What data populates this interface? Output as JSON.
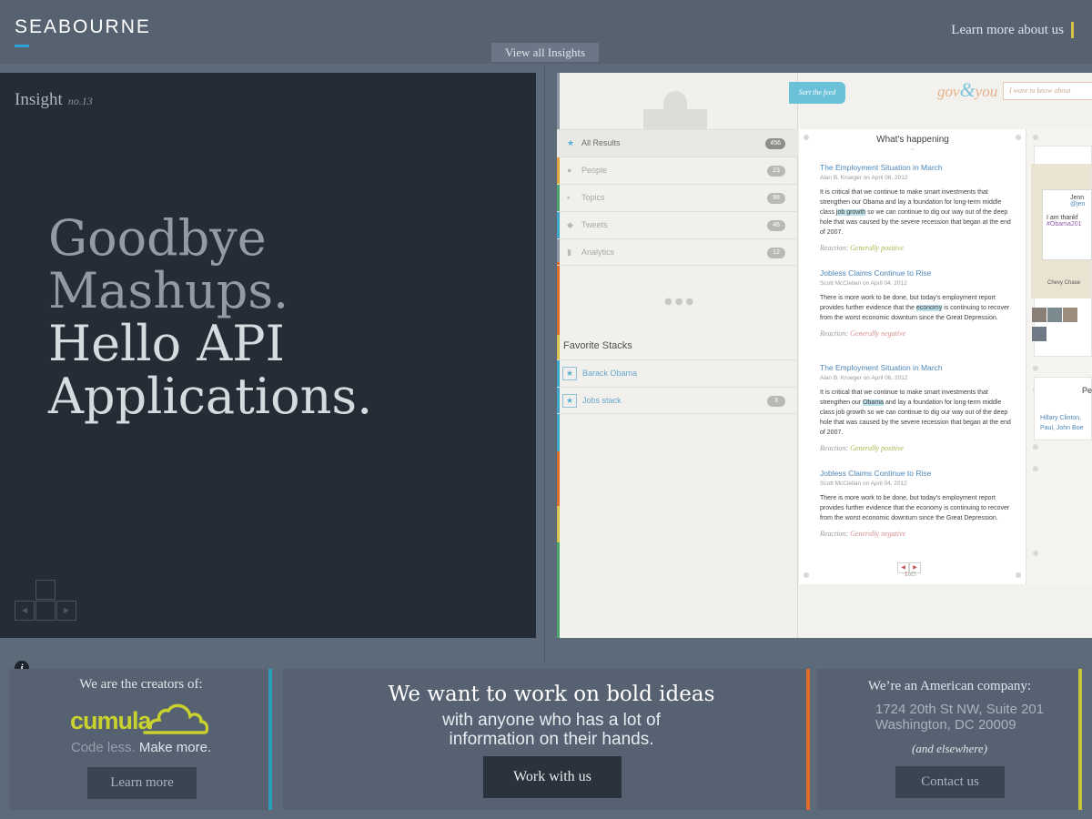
{
  "header": {
    "brand": "SEABOURNE",
    "learn_about": "Learn more about us",
    "view_all": "View all Insights"
  },
  "insight": {
    "label": "Insight",
    "number": "no.13",
    "headline": [
      "Goodbye",
      "Mashups.",
      "Hello API",
      "Applications."
    ]
  },
  "app": {
    "sort_label": "Sort the feed",
    "logo_gov": "gov",
    "logo_amp": "&",
    "logo_you": "you",
    "search_placeholder": "I want to know about",
    "menu": [
      {
        "label": "All Results",
        "count": "456"
      },
      {
        "label": "People",
        "count": "23"
      },
      {
        "label": "Topics",
        "count": "98"
      },
      {
        "label": "Tweets",
        "count": "46"
      },
      {
        "label": "Analytics",
        "count": "12"
      }
    ],
    "favorites_title": "Favorite Stacks",
    "favorites": [
      {
        "label": "Barack Obama",
        "count": ""
      },
      {
        "label": "Jobs stack",
        "count": "3"
      }
    ],
    "feed_title": "What's happening",
    "articles": [
      {
        "title": "The Employment Situation in March",
        "byline": "Alan B. Krueger on April 06, 2012",
        "body_a": "It is critical that we continue to make smart investments that strengthen our Obama and lay a foundation for long-term middle class ",
        "highlight": "job growth",
        "body_b": " so we can continue to dig our way out of the deep hole that was caused by the severe recession that began at the end of 2007.",
        "reaction_label": "Reaction:",
        "reaction": "Generally positive"
      },
      {
        "title": "Jobless Claims Continue to Rise",
        "byline": "Scott McClellan on April 04, 2012",
        "body_a": "There is more work to be done, but today's employment report provides further evidence that the ",
        "highlight": "economy",
        "body_b": " is continuing to recover from the worst economic downturn since the Great Depression.",
        "reaction_label": "Reaction:",
        "reaction": "Generally negative"
      },
      {
        "title": "The Employment Situation in March",
        "byline": "Alan B. Krueger on April 06, 2012",
        "body_a": "It is critical that we continue to make smart investments that strengthen our ",
        "highlight": "Obama",
        "body_b": " and lay a foundation for long-term middle class job growth so we can continue to dig our way out of the deep hole that was caused by the severe recession that began at the end of 2007.",
        "reaction_label": "Reaction:",
        "reaction": "Generally positive"
      },
      {
        "title": "Jobless Claims Continue to Rise",
        "byline": "Scott McClellan on April 04, 2012",
        "body_a": "There is more work to be done, but today's employment report provides further evidence that the economy is continuing to recover from the worst economic downturn since the Great Depression.",
        "highlight": "",
        "body_b": "",
        "reaction_label": "Reaction:",
        "reaction": "Generally negative"
      }
    ],
    "pager": {
      "current": "1",
      "sep": "of",
      "total": "5"
    },
    "map_popup": {
      "name": "Jenn",
      "handle": "@jen",
      "text": "I am thankf",
      "tag": "#Obama201"
    },
    "map_label": "Chevy Chase",
    "people_title": "Pe",
    "people_names": [
      "Hillary Clinton,",
      "Paul, John Boe"
    ]
  },
  "footer": {
    "creators_label": "We are the creators of:",
    "cumula_logo": "cumula",
    "tagline_a": "Code less.",
    "tagline_b": "Make more.",
    "learn_more": "Learn more",
    "bold_ideas": "We want to work on bold ideas",
    "sub_ideas": "with anyone who has a lot of information on their hands.",
    "work_with_us": "Work with us",
    "american": "We’re an American company:",
    "address_line1": "1724 20th St NW, Suite 201",
    "address_line2": "Washington, DC 20009",
    "elsewhere": "(and elsewhere)",
    "contact_us": "Contact  us"
  },
  "colors": {
    "accent_blue": "#2b9fd9",
    "accent_teal": "#2a9fbb",
    "accent_orange": "#e06a28",
    "accent_yellow": "#c7c43c",
    "cumula_green": "#c9d12e"
  }
}
